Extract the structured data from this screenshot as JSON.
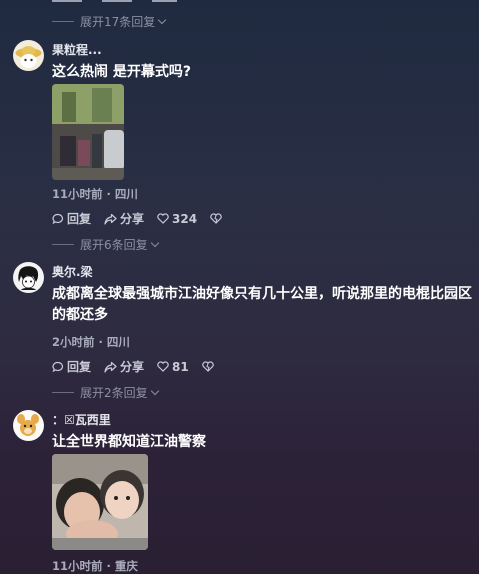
{
  "comments": [
    {
      "username": "果粒程...",
      "text": "这么热闹 是开幕式吗?",
      "meta": "11小时前 · 四川",
      "reply_label": "回复",
      "share_label": "分享",
      "likes": "324"
    },
    {
      "username": "奥尔.梁",
      "text": "成都离全球最强城市江油好像只有几十公里，听说那里的电棍比园区的都还多",
      "meta": "2小时前 · 四川",
      "reply_label": "回复",
      "share_label": "分享",
      "likes": "81"
    },
    {
      "username": "：☒瓦西里",
      "text": "让全世界都知道江油警察",
      "meta": "11小时前 · 重庆"
    }
  ],
  "expand_replies": [
    "展开17条回复",
    "展开6条回复",
    "展开2条回复"
  ]
}
